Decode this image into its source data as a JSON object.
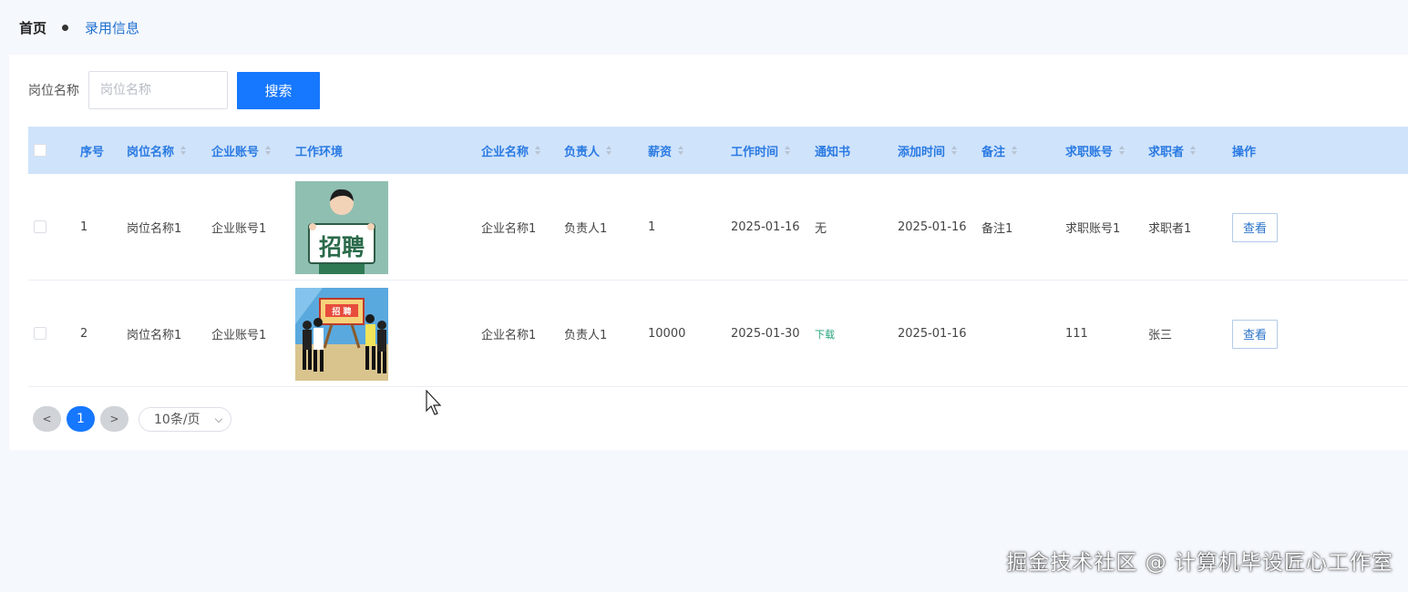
{
  "breadcrumb": {
    "home": "首页",
    "current": "录用信息"
  },
  "search": {
    "label": "岗位名称",
    "placeholder": "岗位名称",
    "value": "",
    "button": "搜索"
  },
  "table": {
    "headers": {
      "index": "序号",
      "job_name": "岗位名称",
      "company_account": "企业账号",
      "environment": "工作环境",
      "company_name": "企业名称",
      "manager": "负责人",
      "salary": "薪资",
      "work_time": "工作时间",
      "notice": "通知书",
      "added_time": "添加时间",
      "remark": "备注",
      "applicant_account": "求职账号",
      "applicant": "求职者",
      "action": "操作"
    },
    "rows": [
      {
        "index": "1",
        "job_name": "岗位名称1",
        "company_account": "企业账号1",
        "environment_image": "recruitment-sign-person",
        "company_name": "企业名称1",
        "manager": "负责人1",
        "salary": "1",
        "work_time": "2025-01-16",
        "notice": "无",
        "added_time": "2025-01-16",
        "remark": "备注1",
        "applicant_account": "求职账号1",
        "applicant": "求职者1",
        "action": "查看"
      },
      {
        "index": "2",
        "job_name": "岗位名称1",
        "company_account": "企业账号1",
        "environment_image": "recruitment-group-board",
        "company_name": "企业名称1",
        "manager": "负责人1",
        "salary": "10000",
        "work_time": "2025-01-30",
        "notice": "下载",
        "added_time": "2025-01-16",
        "remark": "",
        "applicant_account": "111",
        "applicant": "张三",
        "action": "查看"
      }
    ],
    "images": {
      "sign_text": "招聘",
      "board_text": "招 聘"
    }
  },
  "pagination": {
    "prev": "<",
    "current_page": "1",
    "next": ">",
    "page_size": "10条/页"
  },
  "watermark": "掘金技术社区 @ 计算机毕设匠心工作室",
  "colors": {
    "primary": "#1677ff",
    "header_bg": "#cfe3fb",
    "header_text": "#2a7ae2",
    "download_link": "#22a37a"
  }
}
